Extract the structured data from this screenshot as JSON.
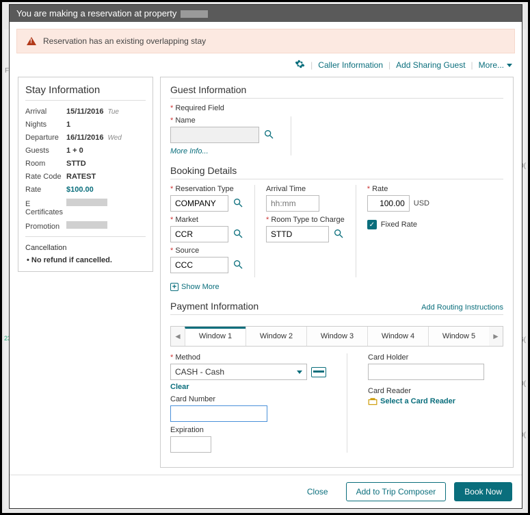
{
  "header": {
    "title": "You are making a reservation at property"
  },
  "alert": {
    "text": "Reservation has an existing overlapping stay"
  },
  "actions": {
    "caller_info": "Caller Information",
    "add_sharing": "Add Sharing Guest",
    "more": "More..."
  },
  "stay": {
    "title": "Stay Information",
    "arrival_label": "Arrival",
    "arrival": "15/11/2016",
    "arrival_day": "Tue",
    "nights_label": "Nights",
    "nights": "1",
    "departure_label": "Departure",
    "departure": "16/11/2016",
    "departure_day": "Wed",
    "guests_label": "Guests",
    "guests": "1 + 0",
    "room_label": "Room",
    "room": "STTD",
    "rate_code_label": "Rate Code",
    "rate_code": "RATEST",
    "rate_label": "Rate",
    "rate": "$100.00",
    "ecert_label": "E Certificates",
    "promo_label": "Promotion",
    "cancellation_label": "Cancellation",
    "cancellation_text": "No refund if cancelled."
  },
  "guest": {
    "title": "Guest Information",
    "required": "Required Field",
    "name_label": "Name",
    "more_info": "More Info..."
  },
  "booking": {
    "title": "Booking Details",
    "res_type_label": "Reservation Type",
    "res_type": "COMPANY",
    "market_label": "Market",
    "market": "CCR",
    "source_label": "Source",
    "source": "CCC",
    "arrival_time_label": "Arrival Time",
    "arrival_time_ph": "hh:mm",
    "room_type_label": "Room Type to Charge",
    "room_type": "STTD",
    "rate_label": "Rate",
    "rate_value": "100.00",
    "rate_currency": "USD",
    "fixed_rate_label": "Fixed Rate",
    "show_more": "Show More"
  },
  "payment": {
    "title": "Payment Information",
    "routing": "Add Routing Instructions",
    "tabs": [
      "Window 1",
      "Window 2",
      "Window 3",
      "Window 4",
      "Window 5"
    ],
    "method_label": "Method",
    "method_value": "CASH - Cash",
    "clear": "Clear",
    "card_number_label": "Card Number",
    "expiration_label": "Expiration",
    "card_holder_label": "Card Holder",
    "card_reader_label": "Card Reader",
    "select_reader": "Select a Card Reader"
  },
  "footer": {
    "close": "Close",
    "add_trip": "Add to Trip Composer",
    "book": "Book Now"
  }
}
